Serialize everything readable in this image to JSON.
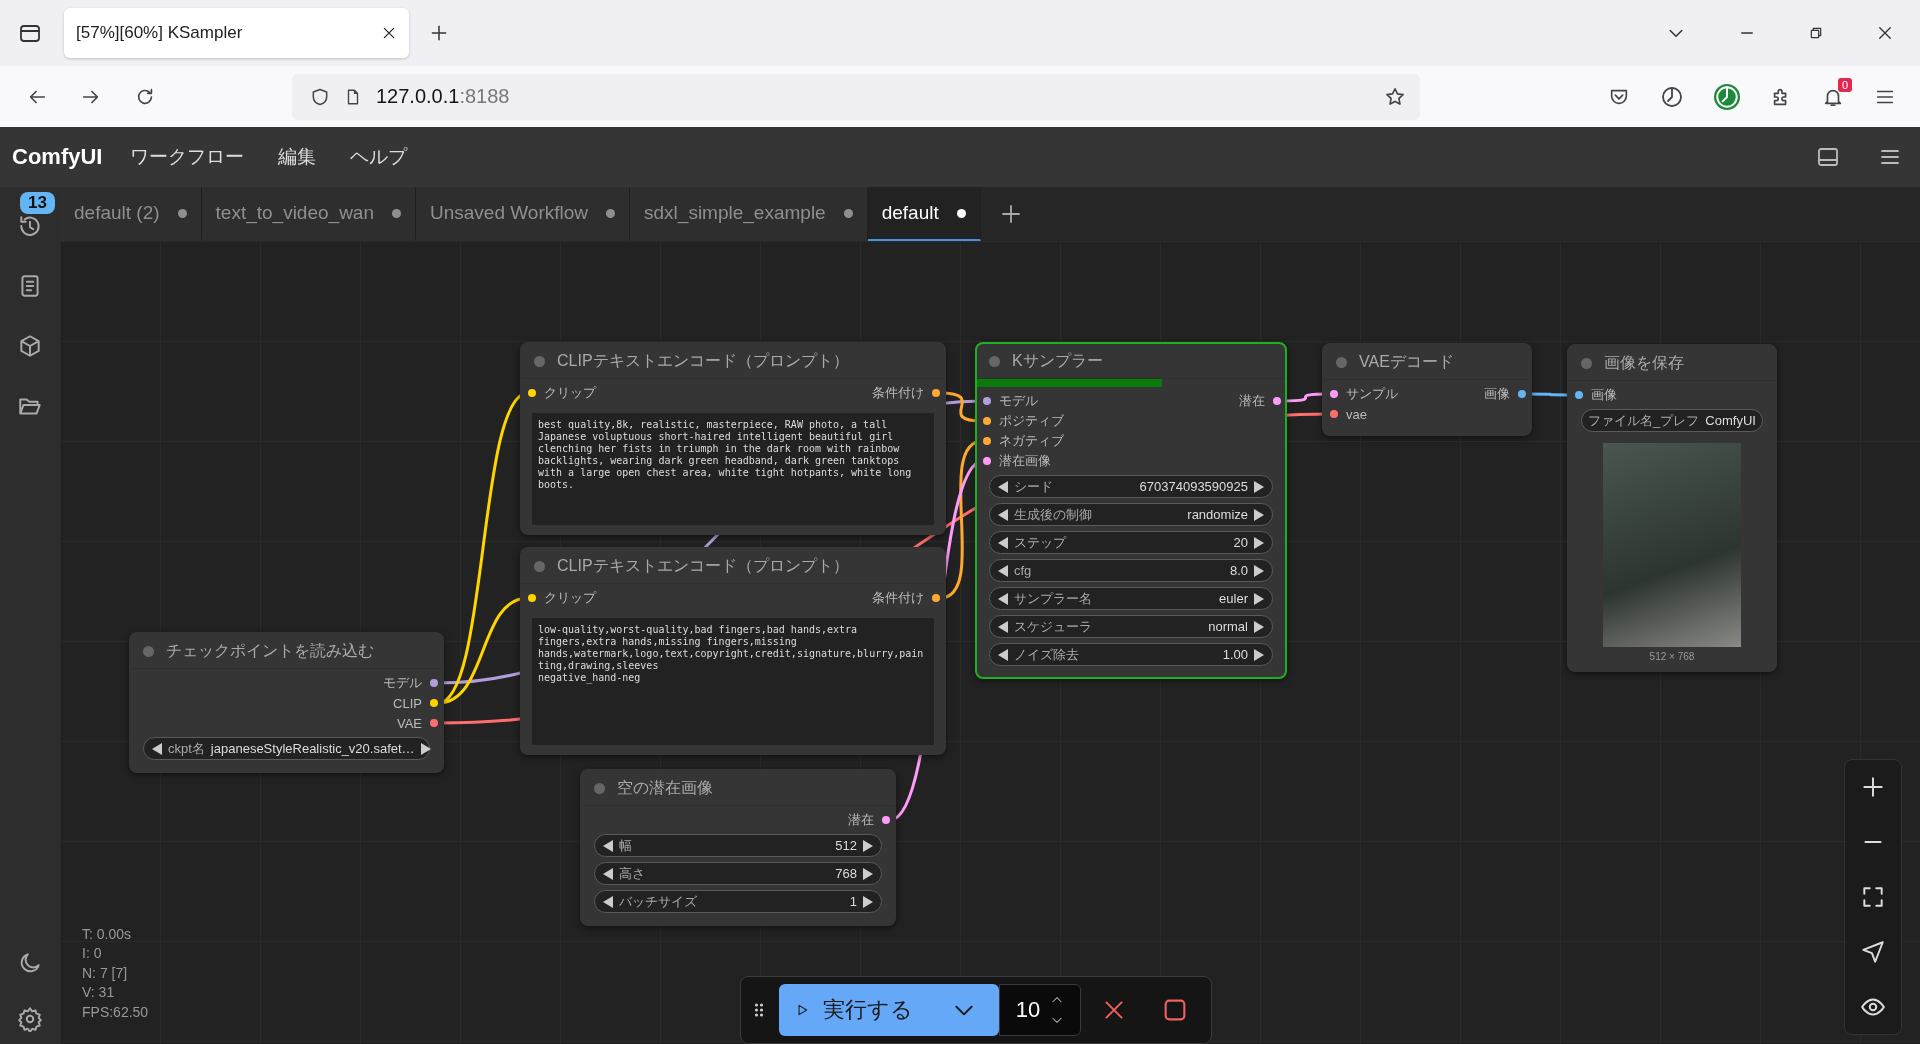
{
  "browser": {
    "tab_title": "[57%][60%] KSampler",
    "url_host": "127.0.0.1",
    "url_port": ":8188",
    "notification_count": "0"
  },
  "menu_bar": {
    "logo": "ComfyUI",
    "items": [
      "ワークフロー",
      "編集",
      "ヘルプ"
    ]
  },
  "sidebar": {
    "queue_badge": "13"
  },
  "workflow_tabs": [
    {
      "label": "default (2)",
      "selected": false,
      "unsaved": true
    },
    {
      "label": "text_to_video_wan",
      "selected": false,
      "unsaved": true
    },
    {
      "label": "Unsaved Workflow",
      "selected": false,
      "unsaved": true
    },
    {
      "label": "sdxl_simple_example",
      "selected": false,
      "unsaved": true
    },
    {
      "label": "default",
      "selected": true,
      "unsaved": true
    }
  ],
  "nodes": [
    {
      "kind": "prompt",
      "title": "CLIPテキストエンコード（プロンプト）",
      "executing": false,
      "inputs": [
        {
          "label": "クリップ",
          "color": "#ffd500"
        }
      ],
      "outputs": [
        {
          "label": "条件付け",
          "color": "#ffa931"
        }
      ],
      "text": "best quality,8k, realistic, masterpiece, RAW photo, a tall Japanese voluptuous short-haired intelligent beautiful girl clenching her fists in triumph in the dark room with rainbow backlights, wearing dark green headband, dark green tanktops with a large open chest area, white tight hotpants, white long boots."
    },
    {
      "kind": "sampler",
      "title": "Kサンプラー",
      "executing": true,
      "level": 0.6,
      "inputs": [
        {
          "label": "モデル",
          "color": "#b39ddb"
        },
        {
          "label": "ポジティブ",
          "color": "#ffa931"
        },
        {
          "label": "ネガティブ",
          "color": "#ffa931"
        },
        {
          "label": "潜在画像",
          "color": "#ff9cf9"
        }
      ],
      "outputs": [
        {
          "label": "潜在",
          "color": "#ff9cf9"
        }
      ],
      "widgets": [
        {
          "kind": "number",
          "label": "シード",
          "value": "670374093590925"
        },
        {
          "kind": "combo",
          "label": "生成後の制御",
          "value": "randomize"
        },
        {
          "kind": "number",
          "label": "ステップ",
          "value": "20"
        },
        {
          "kind": "number",
          "label": "cfg",
          "value": "8.0"
        },
        {
          "kind": "combo",
          "label": "サンプラー名",
          "value": "euler"
        },
        {
          "kind": "combo",
          "label": "スケジューラ",
          "value": "normal"
        },
        {
          "kind": "number",
          "label": "ノイズ除去",
          "value": "1.00"
        }
      ]
    },
    {
      "kind": "standard",
      "title": "VAEデコード",
      "executing": false,
      "inputs": [
        {
          "label": "サンプル",
          "color": "#ff9cf9"
        },
        {
          "label": "vae",
          "color": "#ff6e6e"
        }
      ],
      "outputs": [
        {
          "label": "画像",
          "color": "#64b5f6"
        }
      ]
    },
    {
      "kind": "save",
      "title": "画像を保存",
      "executing": false,
      "inputs": [
        {
          "label": "画像",
          "color": "#64b5f6"
        }
      ],
      "widgets": [
        {
          "kind": "text",
          "label": "ファイル名_プレフ",
          "value": "ComfyUI"
        }
      ],
      "image_caption": "512 × 768"
    },
    {
      "kind": "prompt",
      "title": "CLIPテキストエンコード（プロンプト）",
      "executing": false,
      "inputs": [
        {
          "label": "クリップ",
          "color": "#ffd500"
        }
      ],
      "outputs": [
        {
          "label": "条件付け",
          "color": "#ffa931"
        }
      ],
      "text": "low-quality,worst-quality,bad fingers,bad hands,extra fingers,extra hands,missing fingers,missing\nhands,watermark,logo,text,copyright,credit,signature,blurry,painting,drawing,sleeves\nnegative_hand-neg"
    },
    {
      "kind": "standard",
      "title": "チェックポイントを読み込む",
      "executing": false,
      "outputs": [
        {
          "label": "モデル",
          "color": "#b39ddb"
        },
        {
          "label": "CLIP",
          "color": "#ffd500"
        },
        {
          "label": "VAE",
          "color": "#ff6e6e"
        }
      ],
      "widgets": [
        {
          "kind": "combo",
          "label": "ckpt名",
          "value": "japaneseStyleRealistic_v20.safet…"
        }
      ]
    },
    {
      "kind": "standard",
      "title": "空の潜在画像",
      "executing": false,
      "outputs": [
        {
          "label": "潜在",
          "color": "#ff9cf9"
        }
      ],
      "widgets": [
        {
          "kind": "number",
          "label": "幅",
          "value": "512"
        },
        {
          "kind": "number",
          "label": "高さ",
          "value": "768"
        },
        {
          "kind": "number",
          "label": "バッチサイズ",
          "value": "1"
        }
      ]
    }
  ],
  "stats": [
    "T: 0.00s",
    "I: 0",
    "N: 7 [7]",
    "V: 31",
    "FPS:62.50"
  ],
  "run_bar": {
    "run_label": "実行する",
    "batch_count": "10"
  }
}
